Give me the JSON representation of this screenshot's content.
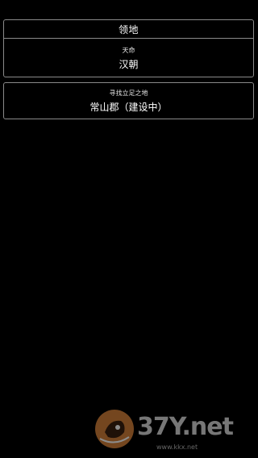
{
  "territory": {
    "header": "领地",
    "mandate_label": "天命",
    "mandate_value": "汉朝"
  },
  "quest": {
    "label": "寻找立足之地",
    "value": "常山郡（建设中）"
  },
  "watermark": {
    "logo_text": "37Y.net",
    "url": "www.kkx.net"
  },
  "colors": {
    "background": "#000000",
    "border": "#8a8a8a",
    "text": "#ffffff",
    "watermark_accent": "#d4803a"
  }
}
